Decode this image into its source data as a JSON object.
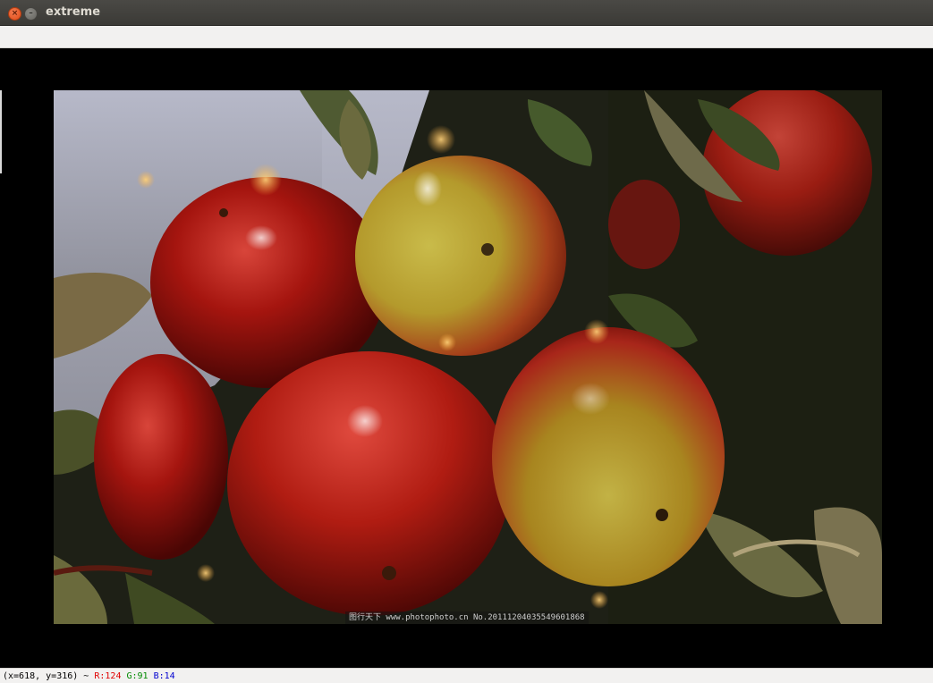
{
  "window": {
    "title": "extreme",
    "close_glyph": "×",
    "minimize_glyph": "–"
  },
  "image": {
    "subject": "apples-on-branch",
    "watermark": "图行天下 www.photophoto.cn  No.20111204035549601868"
  },
  "status": {
    "coords": "(x=618, y=316) ~",
    "r": "R:124",
    "g": "G:91",
    "b": "B:14"
  },
  "colors": {
    "titlebar": "#3b3a36",
    "close_button": "#df4a16",
    "status_r": "#e00000",
    "status_g": "#008a00",
    "status_b": "#0000d0"
  }
}
